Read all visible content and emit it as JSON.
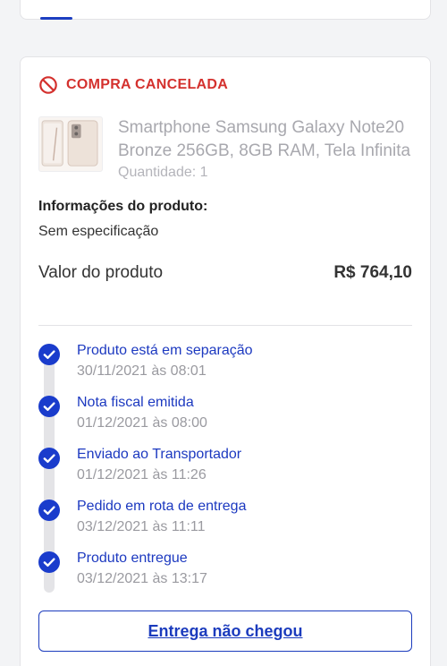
{
  "order": {
    "status": "COMPRA CANCELADA",
    "status_color": "#d4312e",
    "status_icon": "prohibited-icon",
    "product": {
      "name": "Smartphone Samsung Galaxy Note20 Bronze 256GB, 8GB RAM, Tela Infinita",
      "quantity": "Quantidade: 1"
    },
    "info_title": "Informações do produto:",
    "info_value": "Sem especificação",
    "price_label": "Valor do produto",
    "price_value": "R$ 764,10"
  },
  "timeline": [
    {
      "title": "Produto está em separação",
      "date": "30/11/2021 às 08:01"
    },
    {
      "title": "Nota fiscal emitida",
      "date": "01/12/2021 às 08:00"
    },
    {
      "title": "Enviado ao Transportador",
      "date": "01/12/2021 às 11:26"
    },
    {
      "title": "Pedido em rota de entrega",
      "date": "03/12/2021 às 11:11"
    },
    {
      "title": "Produto entregue",
      "date": "03/12/2021 às 13:17"
    }
  ],
  "accent_color": "#1b3bbd",
  "action_button": "Entrega não chegou"
}
